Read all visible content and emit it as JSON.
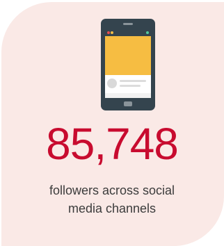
{
  "stat": {
    "value": "85,748",
    "caption_line1": "followers across social",
    "caption_line2": "media channels"
  },
  "icon": "mobile-phone-icon",
  "colors": {
    "card_background": "#fae9e6",
    "number": "#c80b2f",
    "caption": "#3c3c3c",
    "phone_body": "#34444e",
    "screen_image": "#f6bd42"
  }
}
